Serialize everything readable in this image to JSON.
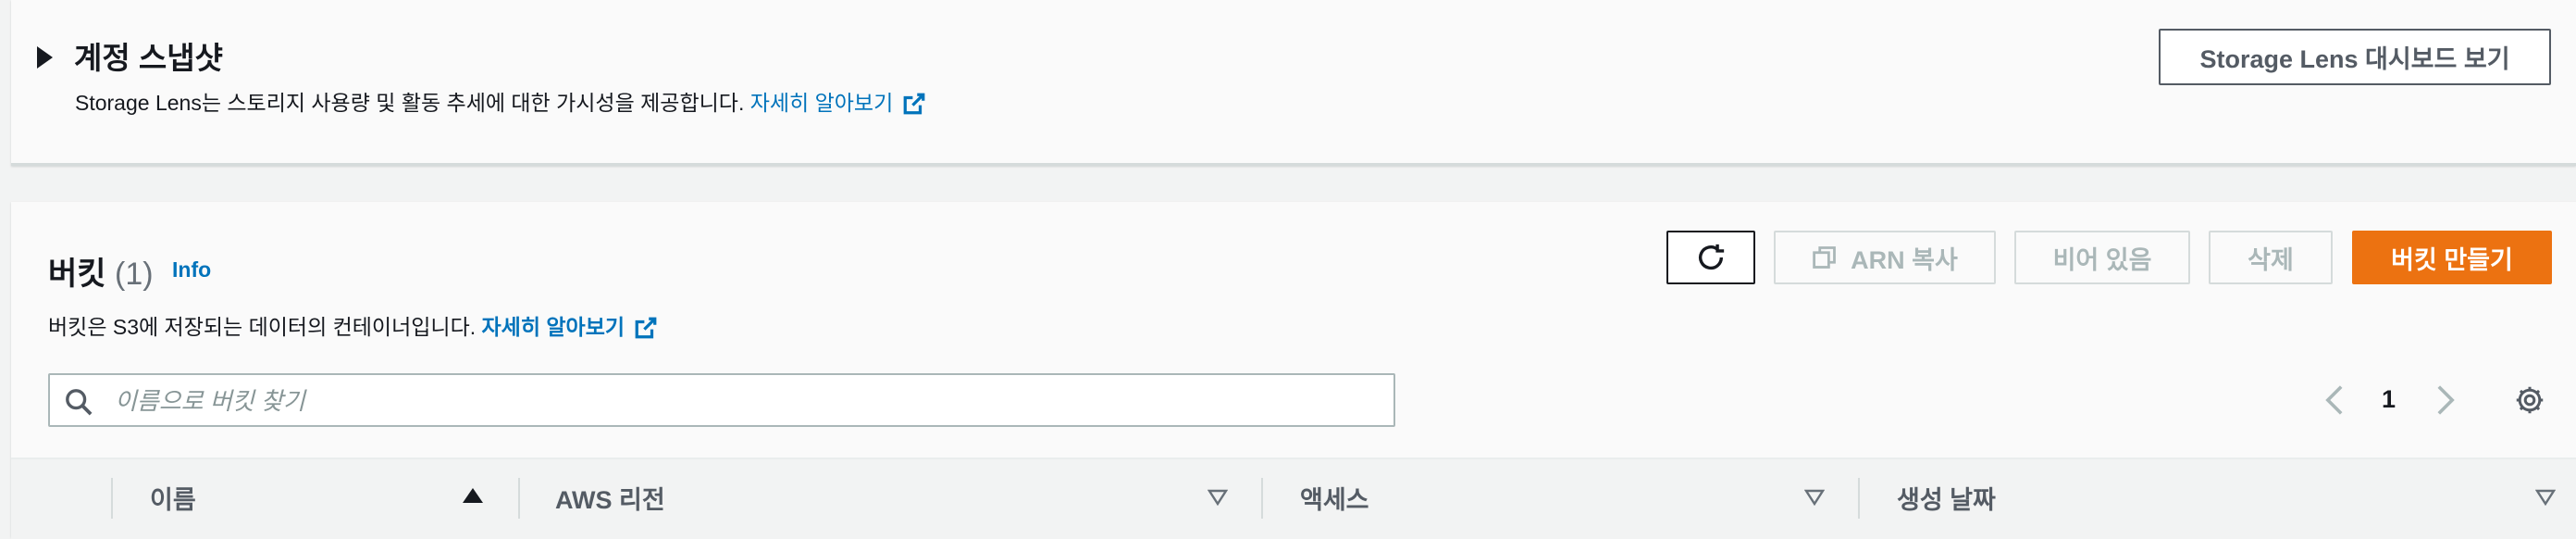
{
  "account_snapshot": {
    "title": "계정 스냅샷",
    "description_prefix": "Storage Lens는 스토리지 사용량 및 활동 추세에 대한 가시성을 제공합니다. ",
    "learn_more": "자세히 알아보기",
    "dashboard_button": "Storage Lens 대시보드 보기"
  },
  "buckets": {
    "title": "버킷",
    "count": "(1)",
    "info": "Info",
    "description_prefix": "버킷은 S3에 저장되는 데이터의 컨테이너입니다. ",
    "learn_more": "자세히 알아보기",
    "buttons": {
      "copy_arn": "ARN 복사",
      "empty": "비어 있음",
      "delete": "삭제",
      "create": "버킷 만들기"
    },
    "search_placeholder": "이름으로 버킷 찾기",
    "pagination": {
      "current_page": "1"
    },
    "columns": [
      {
        "label": "이름",
        "sort": "ascending"
      },
      {
        "label": "AWS 리전",
        "sort": "none"
      },
      {
        "label": "액세스",
        "sort": "none"
      },
      {
        "label": "생성 날짜",
        "sort": "none"
      }
    ]
  },
  "colors": {
    "primary": "#ec7211",
    "link": "#0073bb",
    "text": "#16191f",
    "disabled": "#aab7b8"
  }
}
